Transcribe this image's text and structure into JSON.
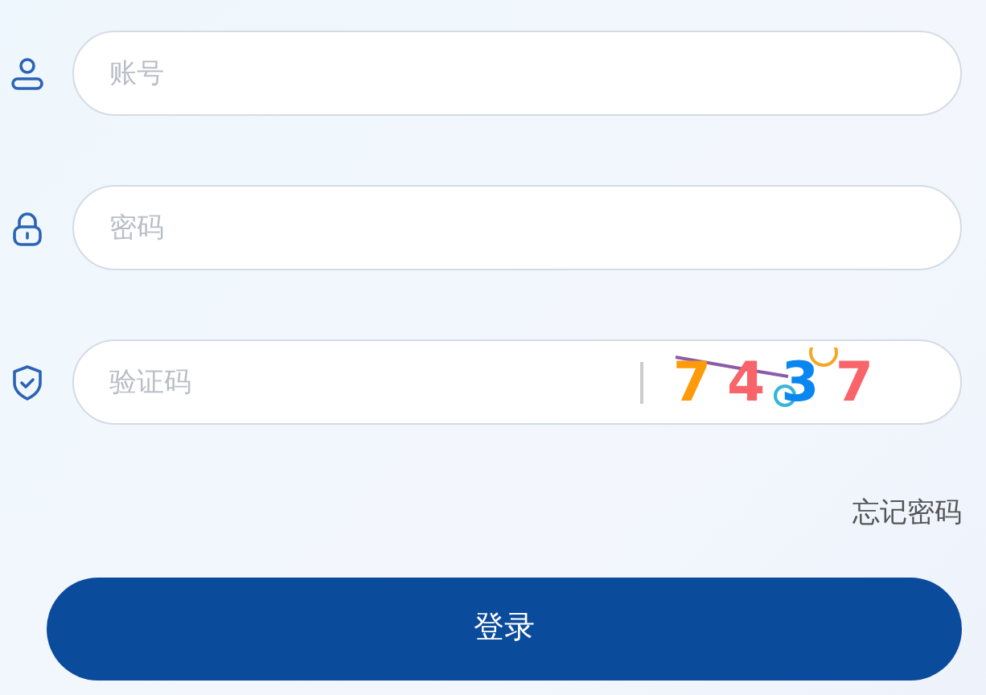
{
  "fields": [
    {
      "kind": "user",
      "placeholder": "账号"
    },
    {
      "kind": "lock",
      "placeholder": "密码"
    },
    {
      "kind": "shield",
      "placeholder": "验证码",
      "captcha": [
        {
          "char": "7",
          "color": "#ff9a0a"
        },
        {
          "char": "4",
          "color": "#f8646a"
        },
        {
          "char": "3",
          "color": "#0a86f0"
        },
        {
          "char": "7",
          "color": "#f8646a"
        }
      ]
    }
  ],
  "forgot_link": "忘记密码",
  "login_button": "登录"
}
